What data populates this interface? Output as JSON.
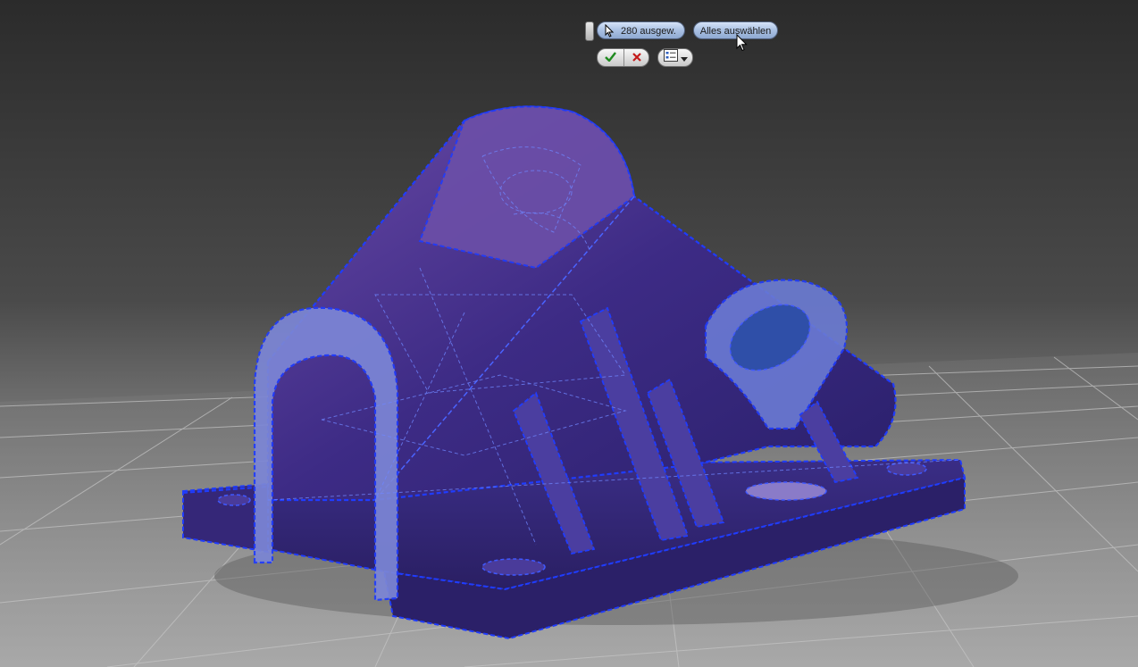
{
  "viewport": {
    "background_top": "#2b2b2b",
    "background_bottom": "#a8a8a8",
    "grid_color": "#c8c8c8",
    "model": {
      "fill": "#3a2a7a",
      "fill_light": "#5a3d98",
      "highlight": "#7f9be6",
      "selection_outline": "#1f3cff"
    }
  },
  "mini_toolbar": {
    "selected_count_label": "280 ausgew.",
    "select_all_label": "Alles auswählen",
    "ok_icon": "checkmark-icon",
    "cancel_icon": "x-icon",
    "options_icon": "list-options-icon"
  }
}
